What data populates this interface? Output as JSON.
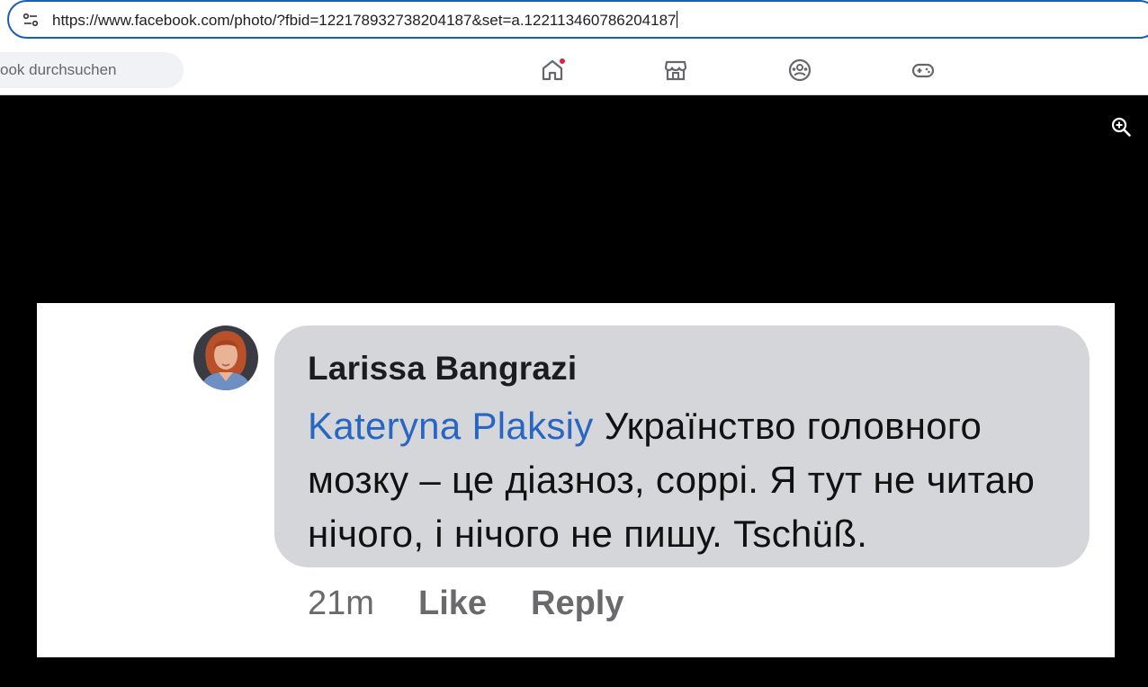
{
  "browser": {
    "url": "https://www.facebook.com/photo/?fbid=122178932738204187&set=a.122113460786204187"
  },
  "fb_nav": {
    "search_placeholder": "ook durchsuchen",
    "icons": [
      "home-icon",
      "marketplace-icon",
      "groups-icon",
      "gaming-icon"
    ]
  },
  "viewer": {
    "zoom_icon": "zoom-in-icon"
  },
  "comment": {
    "author": "Larissa Bangrazi",
    "mention": "Kateryna Plaksiy",
    "text": " Українство головного мозку – це діазноз, соррі. Я тут не читаю нічого, і нічого не пишу. Tschüß.",
    "time": "21m",
    "like_label": "Like",
    "reply_label": "Reply"
  },
  "colors": {
    "accent": "#1a5fb4",
    "mention": "#2866c4",
    "notification": "#e41e3f",
    "bubble": "#d5d6da"
  }
}
